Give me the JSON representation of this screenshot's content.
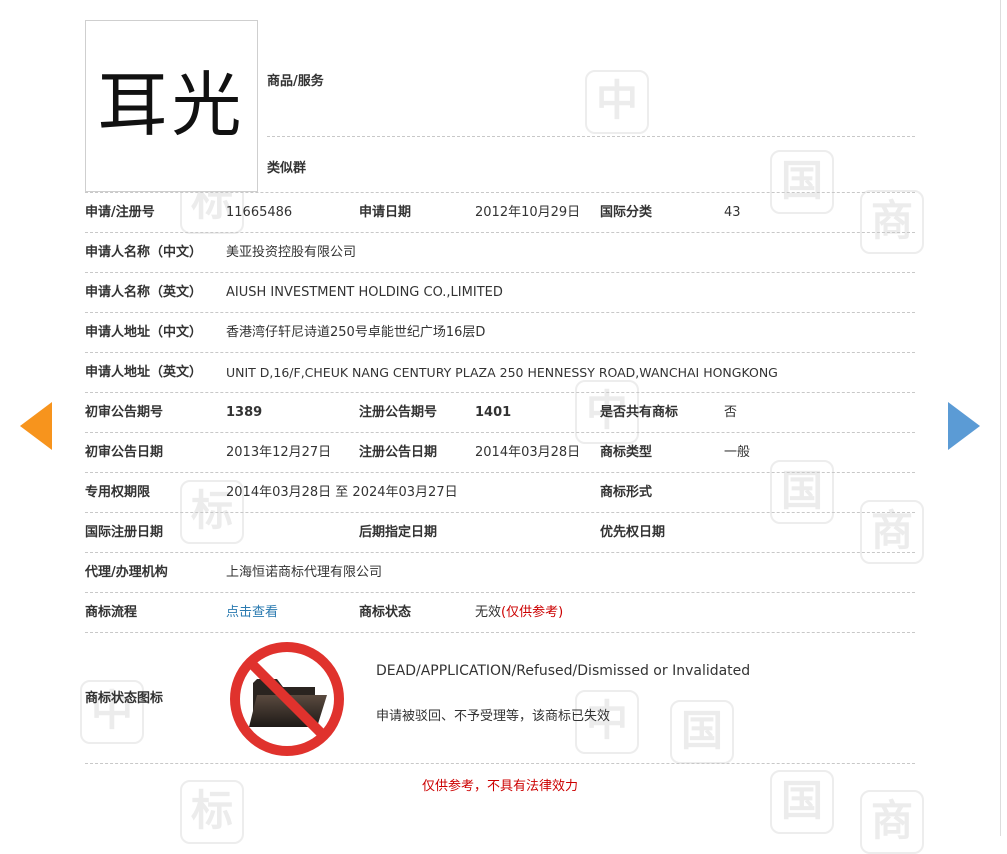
{
  "watermark_chars": [
    "中",
    "国",
    "商",
    "标"
  ],
  "trademark": {
    "text": "耳光"
  },
  "header": {
    "goods_label": "商品/服务",
    "similar_label": "类似群"
  },
  "rows": {
    "r1": {
      "l1": "申请/注册号",
      "v1": "11665486",
      "l2": "申请日期",
      "v2": "2012年10月29日",
      "l3": "国际分类",
      "v3": "43"
    },
    "r2": {
      "l1": "申请人名称（中文）",
      "v1": "美亚投资控股有限公司"
    },
    "r3": {
      "l1": "申请人名称（英文）",
      "v1": "AIUSH INVESTMENT HOLDING CO.,LIMITED"
    },
    "r4": {
      "l1": "申请人地址（中文）",
      "v1": "香港湾仔轩尼诗道250号卓能世纪广场16层D"
    },
    "r5": {
      "l1": "申请人地址（英文）",
      "v1": "UNIT D,16/F,CHEUK NANG CENTURY PLAZA 250 HENNESSY ROAD,WANCHAI HONGKONG"
    },
    "r6": {
      "l1": "初审公告期号",
      "v1": "1389",
      "l2": "注册公告期号",
      "v2": "1401",
      "l3": "是否共有商标",
      "v3": "否"
    },
    "r7": {
      "l1": "初审公告日期",
      "v1": "2013年12月27日",
      "l2": "注册公告日期",
      "v2": "2014年03月28日",
      "l3": "商标类型",
      "v3": "一般"
    },
    "r8": {
      "l1": "专用权期限",
      "v1": "2014年03月28日 至 2024年03月27日",
      "l3": "商标形式"
    },
    "r9": {
      "l1": "国际注册日期",
      "l2": "后期指定日期",
      "l3": "优先权日期"
    },
    "r10": {
      "l1": "代理/办理机构",
      "v1": "上海恒诺商标代理有限公司"
    },
    "r11": {
      "l1": "商标流程",
      "v1": "点击查看",
      "l2": "商标状态",
      "v2": "无效",
      "v2_note": "(仅供参考)"
    }
  },
  "status_block": {
    "label": "商标状态图标",
    "icon": "prohibited-folder-icon",
    "text_en": "DEAD/APPLICATION/Refused/Dismissed or Invalidated",
    "text_cn": "申请被驳回、不予受理等，该商标已失效"
  },
  "disclaimer": "仅供参考，不具有法律效力",
  "colors": {
    "arrow_prev": "#f7941d",
    "arrow_next": "#5b9bd5",
    "link": "#2a7ab0",
    "warning": "#cc0000",
    "prohibit_red": "#e0322d"
  }
}
